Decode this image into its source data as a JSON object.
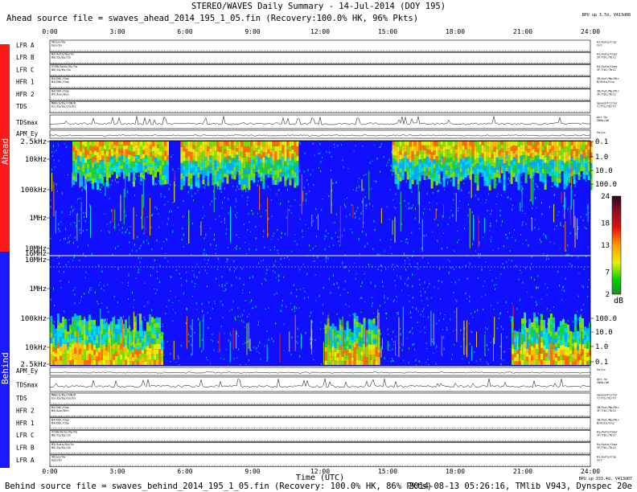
{
  "title": "STEREO/WAVES Daily Summary - 14-Jul-2014 (DOY 195)",
  "ahead_source": "Ahead source file = swaves_ahead_2014_195_1_05.fin (Recovery:100.0% HK, 96% Pkts)",
  "behind_source": "Behind source file = swaves_behind_2014_195_1_05.fin (Recovery: 100.0% HK, 86% Pkts)",
  "footer_right": "2014-08-13 05:26:16, TMlib V943, Dynspec 20e",
  "ahead_version": "BPU up 3.7d, V413d08",
  "behind_version": "BPU up 333.4d, V413d07",
  "xlabel": "Time (UTC)",
  "spacecraft": {
    "ahead": "Ahead",
    "behind": "Behind"
  },
  "colors": {
    "ahead_bar": "#ff1a1a",
    "behind_bar": "#1a1aff",
    "background": "#1010ff"
  },
  "chart_data": {
    "type": "heatmap",
    "x_range_hours": [
      0,
      24
    ],
    "time_ticks": [
      "0:00",
      "3:00",
      "6:00",
      "9:00",
      "12:00",
      "15:00",
      "18:00",
      "21:00",
      "24:00"
    ],
    "time_ticks_bottom": [
      "0:00",
      "3:00",
      "6:00",
      "9:00",
      "12:00",
      "15:00",
      "18:00",
      "21:00",
      "24:00"
    ],
    "ahead_freq_labels": [
      "2.5kHz",
      "10kHz",
      "100kHz",
      "1MHz",
      "10MHz"
    ],
    "behind_freq_labels": [
      "16MHz",
      "10MHz",
      "1MHz",
      "100kHz",
      "10kHz",
      "2.5kHz"
    ],
    "ahead_right_labels": [
      "0.1",
      "1.0",
      "10.0",
      "100.0"
    ],
    "behind_right_labels": [
      "100.0",
      "10.0",
      "1.0",
      "0.1"
    ],
    "colorbar": {
      "ticks": [
        "24",
        "18",
        "13",
        "7",
        "2"
      ],
      "unit": "dB",
      "range": [
        2,
        24
      ]
    },
    "ahead_activity_hours": [
      [
        1.0,
        5.2
      ],
      [
        5.8,
        11.0
      ],
      [
        15.2,
        24.0
      ]
    ],
    "behind_activity_hours": [
      [
        0.0,
        5.0
      ],
      [
        12.2,
        14.6
      ],
      [
        20.5,
        24.0
      ]
    ]
  },
  "ahead_panels": [
    {
      "label": "LFR A",
      "l1": "VDiwv/Vw",
      "l2": "Epo/Ev",
      "r1": "Hi/Auto/Cnp",
      "r2": "Cnt"
    },
    {
      "label": "LFR B",
      "l1": "B3/Auto/Dw/Vs",
      "l2": "B0/Zp/Ep/Zo",
      "r1": "Hi/Auto/Cmpr",
      "r2": "IF/Tbl/Tbl2"
    },
    {
      "label": "LFR C",
      "l1": "V23B/Auto/Dy/Vs",
      "l2": "B0/Zp/Ep/Zo",
      "r1": "Hi/Auto/Cmpr",
      "r2": "IF/Tbl/Tbl2"
    },
    {
      "label": "HFR 1",
      "l1": "B4/Dbl/Cmp",
      "l2": "B4/Dbl/Cmp",
      "r1": "IB/Aut/Mp/Mir",
      "r2": "B/Auto/Cnp"
    },
    {
      "label": "HFR 2",
      "l1": "B4/Dbl/Cmp",
      "l2": "B4/Aux/Dev",
      "r1": "IB/Aut/Mp/Mir",
      "r2": "IF/Tbl/Tbl2"
    },
    {
      "label": "TDS",
      "l1": "M08/p/Dy/V3B/R",
      "l2": "Ex/Zp/Ep/Zo/Ex",
      "r1": "Speed/Filter",
      "r2": "T/TTS/TU/TV"
    }
  ],
  "ahead_tdsmax": {
    "label": "TDSmax",
    "r1": "Ant Hz",
    "r2": "Z8Nv/AH"
  },
  "ahead_apm": {
    "label": "APM_Ey",
    "r1": "Voltz"
  },
  "behind_apm": {
    "label": "APM_Ey",
    "r1": "Voltz"
  },
  "behind_tdsmax": {
    "label": "TDSmax",
    "r1": "Ant Hz",
    "r2": "Z8Nv/AH"
  },
  "behind_panels": [
    {
      "label": "TDS",
      "l1": "M08/p/Dy/V3B/R",
      "l2": "Ex/Zp/Ep/Zo/Ex",
      "r1": "Speed/Filter",
      "r2": "T/TTS/TU/TV"
    },
    {
      "label": "HFR 2",
      "l1": "B4/Dbl/Cmp",
      "l2": "B4/Aux/Dev",
      "r1": "IB/Aut/Mp/Mir",
      "r2": "IF/Tbl/Tbl2"
    },
    {
      "label": "HFR 1",
      "l1": "B4/Dbl/Cmp",
      "l2": "B4/Dbl/Cmp",
      "r1": "IB/Aut/Mp/Mir",
      "r2": "B/Auto/Cnp"
    },
    {
      "label": "LFR C",
      "l1": "V23B/Auto/Dy/Vs",
      "l2": "B0/Zp/Ep/Zo",
      "r1": "Hi/Auto/Cmpr",
      "r2": "IF/Tbl/Tbl2"
    },
    {
      "label": "LFR B",
      "l1": "B3/Auto/Dw/Vs",
      "l2": "B0/Zp/Ep/Zo",
      "r1": "Hi/Auto/Cmpr",
      "r2": "IF/Tbl/Tbl2"
    },
    {
      "label": "LFR A",
      "l1": "VDiwv/Vw",
      "l2": "Epo/Ev",
      "r1": "Hi/Auto/Cnp",
      "r2": "Cnt"
    }
  ]
}
